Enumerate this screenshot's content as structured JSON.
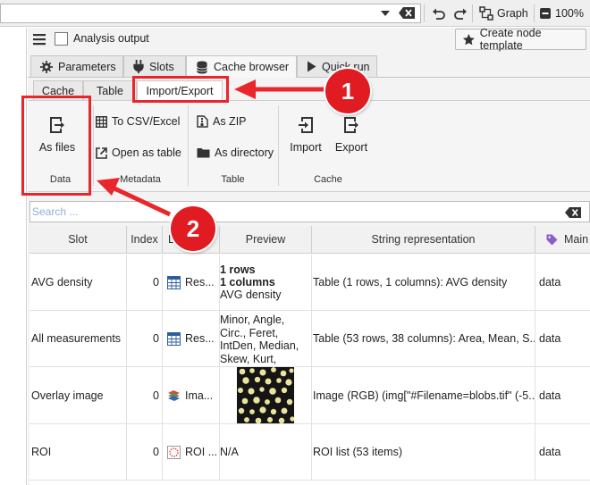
{
  "topbar": {
    "graph_label": "Graph",
    "zoom_label": "100%"
  },
  "analysis": {
    "checkbox_label": "Analysis output",
    "create_template_label": "Create node template"
  },
  "main_tabs": [
    {
      "label": "Parameters",
      "icon": "gear-icon"
    },
    {
      "label": "Slots",
      "icon": "plug-icon"
    },
    {
      "label": "Cache browser",
      "icon": "database-icon"
    },
    {
      "label": "Quick run",
      "icon": "play-icon"
    }
  ],
  "sub_tabs": [
    {
      "label": "Cache"
    },
    {
      "label": "Table"
    },
    {
      "label": "Import/Export"
    }
  ],
  "ribbon": {
    "data_group": {
      "label": "Data",
      "as_files": "As files"
    },
    "metadata_group": {
      "label": "Metadata",
      "to_csv": "To CSV/Excel",
      "open_as_table": "Open as table"
    },
    "table_group": {
      "label": "Table",
      "as_zip": "As ZIP",
      "as_directory": "As directory"
    },
    "cache_group": {
      "label": "Cache",
      "import": "Import",
      "export": "Export"
    }
  },
  "search": {
    "placeholder": "Search ..."
  },
  "table": {
    "headers": [
      "Slot",
      "Index",
      "D",
      "Preview",
      "String representation",
      "Main"
    ],
    "rows": [
      {
        "slot": "AVG density",
        "index": "0",
        "type": "Res...",
        "preview_lines": [
          "1 rows",
          "1 columns",
          "AVG density"
        ],
        "string": "Table (1 rows, 1 columns): AVG density",
        "main": "data"
      },
      {
        "slot": "All measurements",
        "index": "0",
        "type": "Res...",
        "preview_lines": [
          "Minor, Angle,",
          "Circ., Feret,",
          "IntDen, Median,",
          "Skew, Kurt,"
        ],
        "string": "Table (53 rows, 38 columns): Area, Mean, S...",
        "main": "data"
      },
      {
        "slot": "Overlay image",
        "index": "0",
        "type": "Ima...",
        "string": "Image (RGB) (img[\"#Filename=blobs.tif\" (-5...",
        "main": "data"
      },
      {
        "slot": "ROI",
        "index": "0",
        "type": "ROI ...",
        "preview_text": "N/A",
        "string": "ROI list (53 items)",
        "main": "data"
      }
    ]
  },
  "callouts": {
    "one": "1",
    "two": "2"
  },
  "colors": {
    "accent_red": "#e11b22",
    "tab_active_border": "#e8262c"
  }
}
